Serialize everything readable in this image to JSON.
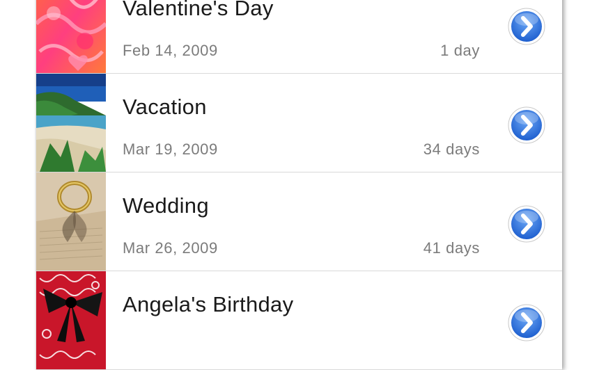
{
  "events": [
    {
      "title": "Valentine's Day",
      "date": "Feb 14, 2009",
      "remaining": "1 day",
      "thumb_icon": "valentine-pattern-thumbnail"
    },
    {
      "title": "Vacation",
      "date": "Mar 19, 2009",
      "remaining": "34 days",
      "thumb_icon": "beach-thumbnail"
    },
    {
      "title": "Wedding",
      "date": "Mar 26, 2009",
      "remaining": "41 days",
      "thumb_icon": "wedding-rings-thumbnail"
    },
    {
      "title": "Angela's Birthday",
      "date": "",
      "remaining": "",
      "thumb_icon": "gift-bow-thumbnail"
    }
  ],
  "colors": {
    "disclosure_blue": "#2f6fd6",
    "title_text": "#1a1a1a",
    "detail_text": "#7b7b7b"
  }
}
